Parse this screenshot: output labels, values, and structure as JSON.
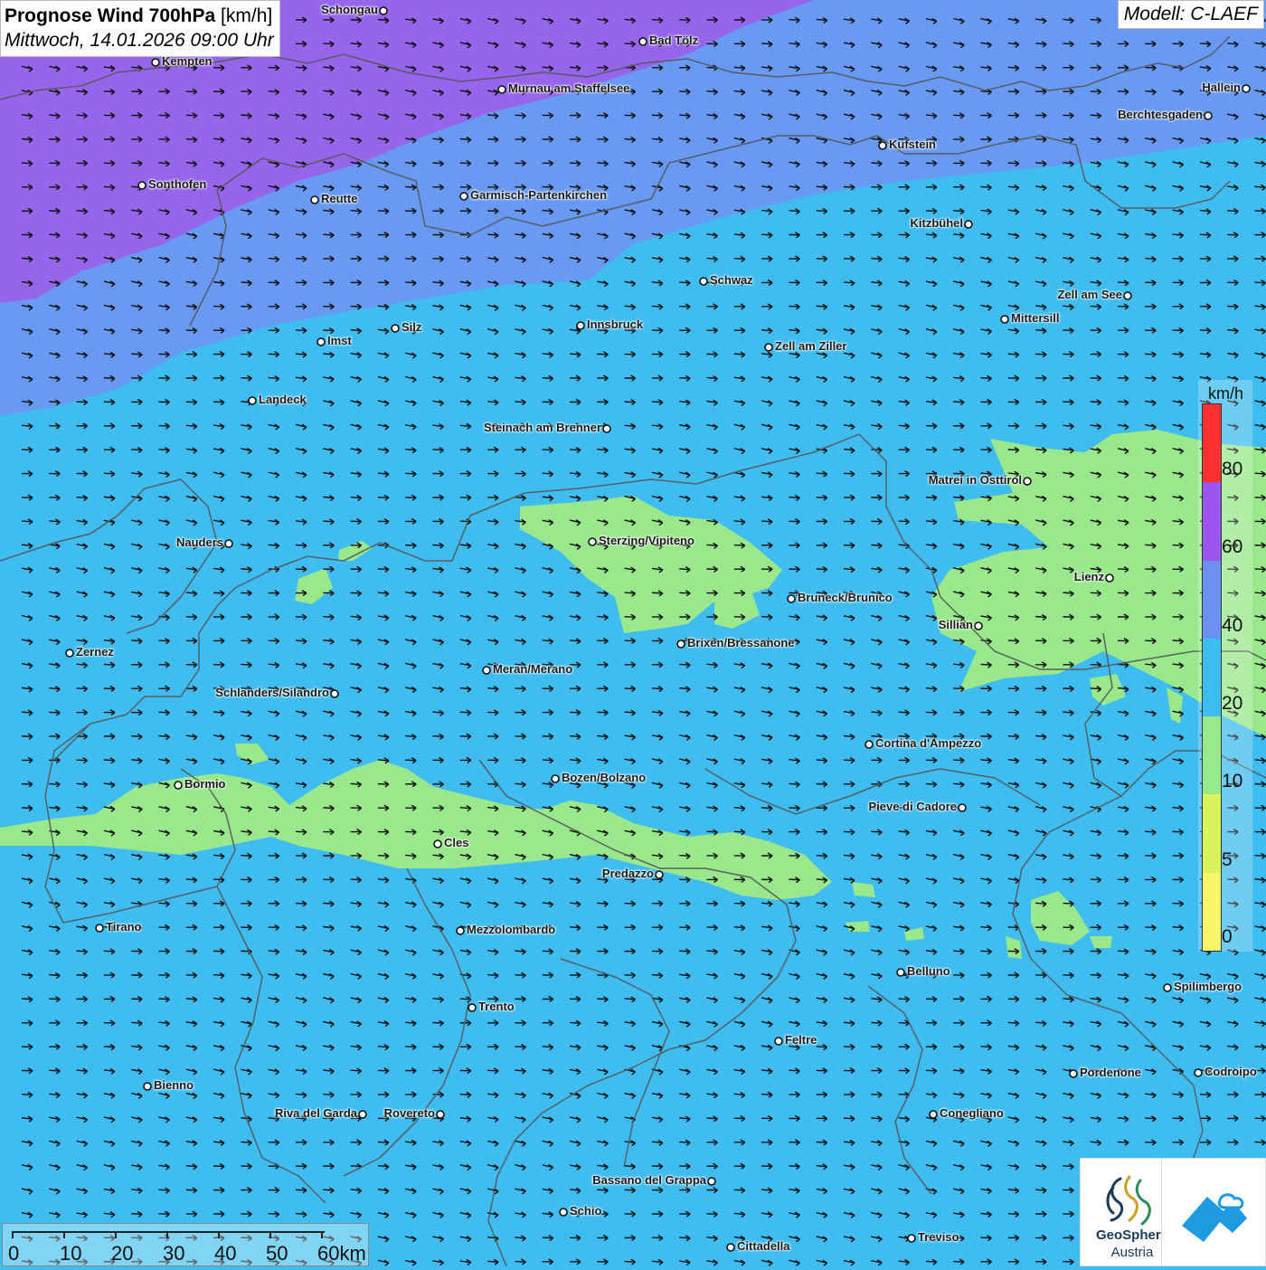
{
  "header": {
    "title": "Prognose Wind 700hPa",
    "unit": " [km/h]",
    "subtitle": "Mittwoch, 14.01.2026 09:00 Uhr",
    "model": "Modell: C-LAEF"
  },
  "cities": [
    {
      "name": "Schongau",
      "label_left": true
    },
    {
      "name": "Bad Tölz",
      "label_left": false
    },
    {
      "name": "Kempten",
      "label_left": false
    },
    {
      "name": "Murnau am Staffelsee",
      "label_left": false
    },
    {
      "name": "Hallein",
      "label_left": true
    },
    {
      "name": "Berchtesgaden",
      "label_left": true
    },
    {
      "name": "Kufstein",
      "label_left": false
    },
    {
      "name": "Sonthofen",
      "label_left": false
    },
    {
      "name": "Reutte",
      "label_left": false
    },
    {
      "name": "Garmisch-Partenkirchen",
      "label_left": false
    },
    {
      "name": "Kitzbühel",
      "label_left": true
    },
    {
      "name": "Schwaz",
      "label_left": false
    },
    {
      "name": "Zell am See",
      "label_left": true
    },
    {
      "name": "Mittersill",
      "label_left": false
    },
    {
      "name": "Innsbruck",
      "label_left": false
    },
    {
      "name": "Silz",
      "label_left": false
    },
    {
      "name": "Imst",
      "label_left": false
    },
    {
      "name": "Zell am Ziller",
      "label_left": false
    },
    {
      "name": "Landeck",
      "label_left": false
    },
    {
      "name": "Steinach am Brenner",
      "label_left": true
    },
    {
      "name": "Matrei in Osttirol",
      "label_left": true
    },
    {
      "name": "Nauders",
      "label_left": true
    },
    {
      "name": "Sterzing/Vipiteno",
      "label_left": false
    },
    {
      "name": "Lienz",
      "label_left": true
    },
    {
      "name": "Bruneck/Brunico",
      "label_left": false
    },
    {
      "name": "Sillian",
      "label_left": true
    },
    {
      "name": "Brixen/Bressanone",
      "label_left": false
    },
    {
      "name": "Zernez",
      "label_left": false
    },
    {
      "name": "Meran/Merano",
      "label_left": false
    },
    {
      "name": "Schlanders/Silandro",
      "label_left": true
    },
    {
      "name": "Cortina d'Ampezzo",
      "label_left": false
    },
    {
      "name": "Bozen/Bolzano",
      "label_left": false
    },
    {
      "name": "Bormio",
      "label_left": false
    },
    {
      "name": "Pieve di Cadore",
      "label_left": true
    },
    {
      "name": "Cles",
      "label_left": false
    },
    {
      "name": "Predazzo",
      "label_left": true
    },
    {
      "name": "Tirano",
      "label_left": false
    },
    {
      "name": "Mezzolombardo",
      "label_left": false
    },
    {
      "name": "Belluno",
      "label_left": false
    },
    {
      "name": "Spilimbergo",
      "label_left": false
    },
    {
      "name": "Trento",
      "label_left": false
    },
    {
      "name": "Feltre",
      "label_left": false
    },
    {
      "name": "Pordenone",
      "label_left": false
    },
    {
      "name": "Codroipo",
      "label_left": false
    },
    {
      "name": "Bienno",
      "label_left": false
    },
    {
      "name": "Riva del Garda",
      "label_left": true
    },
    {
      "name": "Rovereto",
      "label_left": true
    },
    {
      "name": "Conegliano",
      "label_left": false
    },
    {
      "name": "Bassano del Grappa",
      "label_left": true
    },
    {
      "name": "Schio",
      "label_left": false
    },
    {
      "name": "Treviso",
      "label_left": false
    },
    {
      "name": "Cittadella",
      "label_left": false
    }
  ],
  "legend": {
    "unit": "km/h",
    "labels": [
      "80",
      "60",
      "40",
      "20",
      "10",
      "5",
      "0"
    ],
    "colors": [
      "#ff3030",
      "#9b55ee",
      "#6b90f0",
      "#3cbdf0",
      "#95ea8a",
      "#d8f45a",
      "#f7f56a"
    ]
  },
  "scale_bar": {
    "labels": [
      "0",
      "10",
      "20",
      "30",
      "40",
      "50",
      "60km"
    ]
  },
  "logos": {
    "geosphere_line1": "GeoSphere",
    "geosphere_line2": "Austria"
  },
  "colors": {
    "wind_20_40": "#3fbdf0",
    "wind_40_60": "#6b98f2",
    "wind_60_80": "#9a62ea",
    "wind_10_20": "#9ae88c",
    "border": "#555555",
    "arrow": "#111111"
  }
}
